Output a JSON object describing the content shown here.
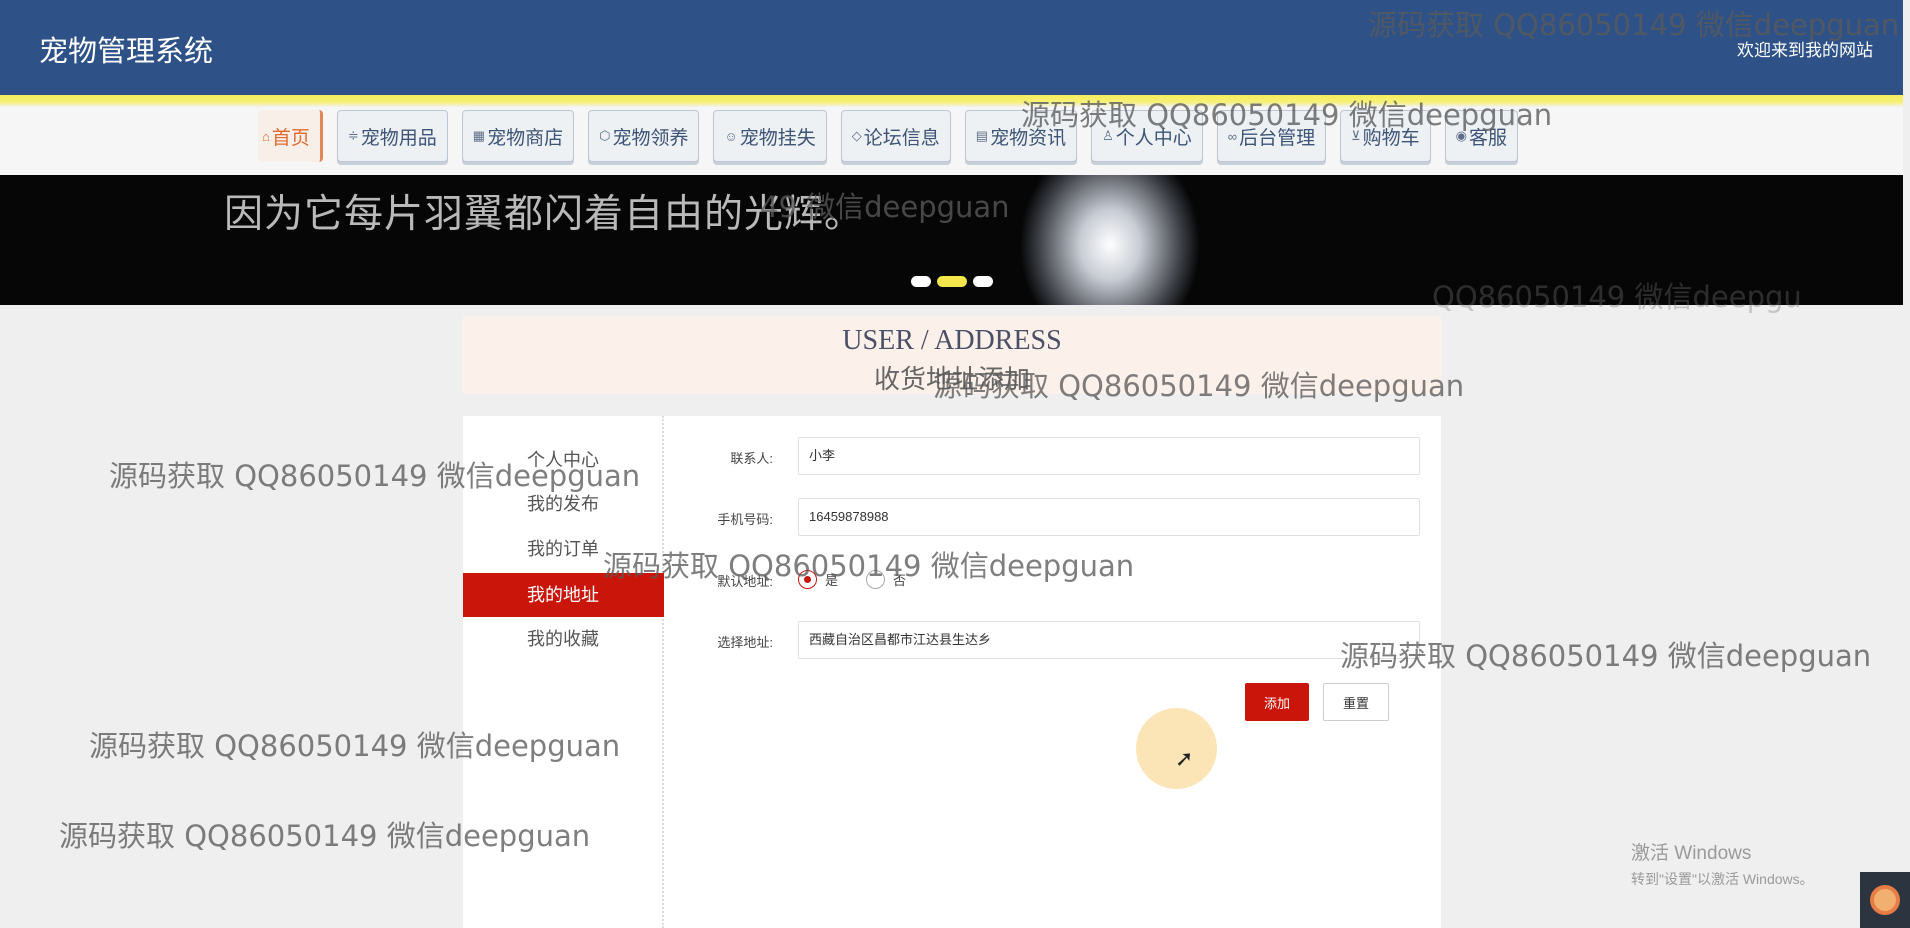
{
  "header": {
    "title": "宠物管理系统",
    "welcome": "欢迎来到我的网站"
  },
  "nav": [
    {
      "label": "首页",
      "icon": "home-icon",
      "glyph": "⌂",
      "active": true
    },
    {
      "label": "宠物用品",
      "icon": "sliders-icon",
      "glyph": "≑",
      "active": false
    },
    {
      "label": "宠物商店",
      "icon": "calendar-icon",
      "glyph": "▦",
      "active": false
    },
    {
      "label": "宠物领养",
      "icon": "box-icon",
      "glyph": "⬡",
      "active": false
    },
    {
      "label": "宠物挂失",
      "icon": "smile-icon",
      "glyph": "☺",
      "active": false
    },
    {
      "label": "论坛信息",
      "icon": "tag-icon",
      "glyph": "◇",
      "active": false
    },
    {
      "label": "宠物资讯",
      "icon": "newspaper-icon",
      "glyph": "▤",
      "active": false
    },
    {
      "label": "个人中心",
      "icon": "user-icon",
      "glyph": "♙",
      "active": false
    },
    {
      "label": "后台管理",
      "icon": "link-icon",
      "glyph": "∞",
      "active": false
    },
    {
      "label": "购物车",
      "icon": "cart-icon",
      "glyph": "⊻",
      "active": false
    },
    {
      "label": "客服",
      "icon": "globe-icon",
      "glyph": "◉",
      "active": false
    }
  ],
  "banner": {
    "text": "因为它每片羽翼都闪着自由的光辉。",
    "slides": 3,
    "active_slide": 2
  },
  "section": {
    "title_en": "USER / ADDRESS",
    "title_cn": "收货地址添加"
  },
  "sidebar": [
    {
      "label": "个人中心",
      "active": false
    },
    {
      "label": "我的发布",
      "active": false
    },
    {
      "label": "我的订单",
      "active": false
    },
    {
      "label": "我的地址",
      "active": true
    },
    {
      "label": "我的收藏",
      "active": false
    }
  ],
  "form": {
    "contact_label": "联系人:",
    "contact_value": "小李",
    "phone_label": "手机号码:",
    "phone_value": "16459878988",
    "default_label": "默认地址:",
    "default_yes": "是",
    "default_no": "否",
    "default_selected": "是",
    "address_label": "选择地址:",
    "address_value": "西藏自治区昌都市江达县生达乡",
    "add_button": "添加",
    "reset_button": "重置"
  },
  "watermarks": [
    "源码获取 QQ86050149 微信deepguan",
    "源码获取 QQ86050149 微信deepguan",
    "49 微信deepguan",
    "QQ86050149 微信deepgu",
    "源码获取 QQ86050149 微信deepguan",
    "源码获取 QQ86050149 微信deepguan",
    "源码获取 QQ86050149 微信deepguan",
    "源码获取 QQ86050149 微信deepguan",
    "源码获取 QQ86050149 微信deepguan",
    "源码获取 QQ86050149 微信deepguan"
  ],
  "windows_activation": {
    "line1": "激活 Windows",
    "line2": "转到\"设置\"以激活 Windows。"
  },
  "colors": {
    "header_bg": "#2e5288",
    "accent_red": "#c9150a",
    "nav_active": "#e36a2f",
    "dot_active": "#f3e64d"
  }
}
